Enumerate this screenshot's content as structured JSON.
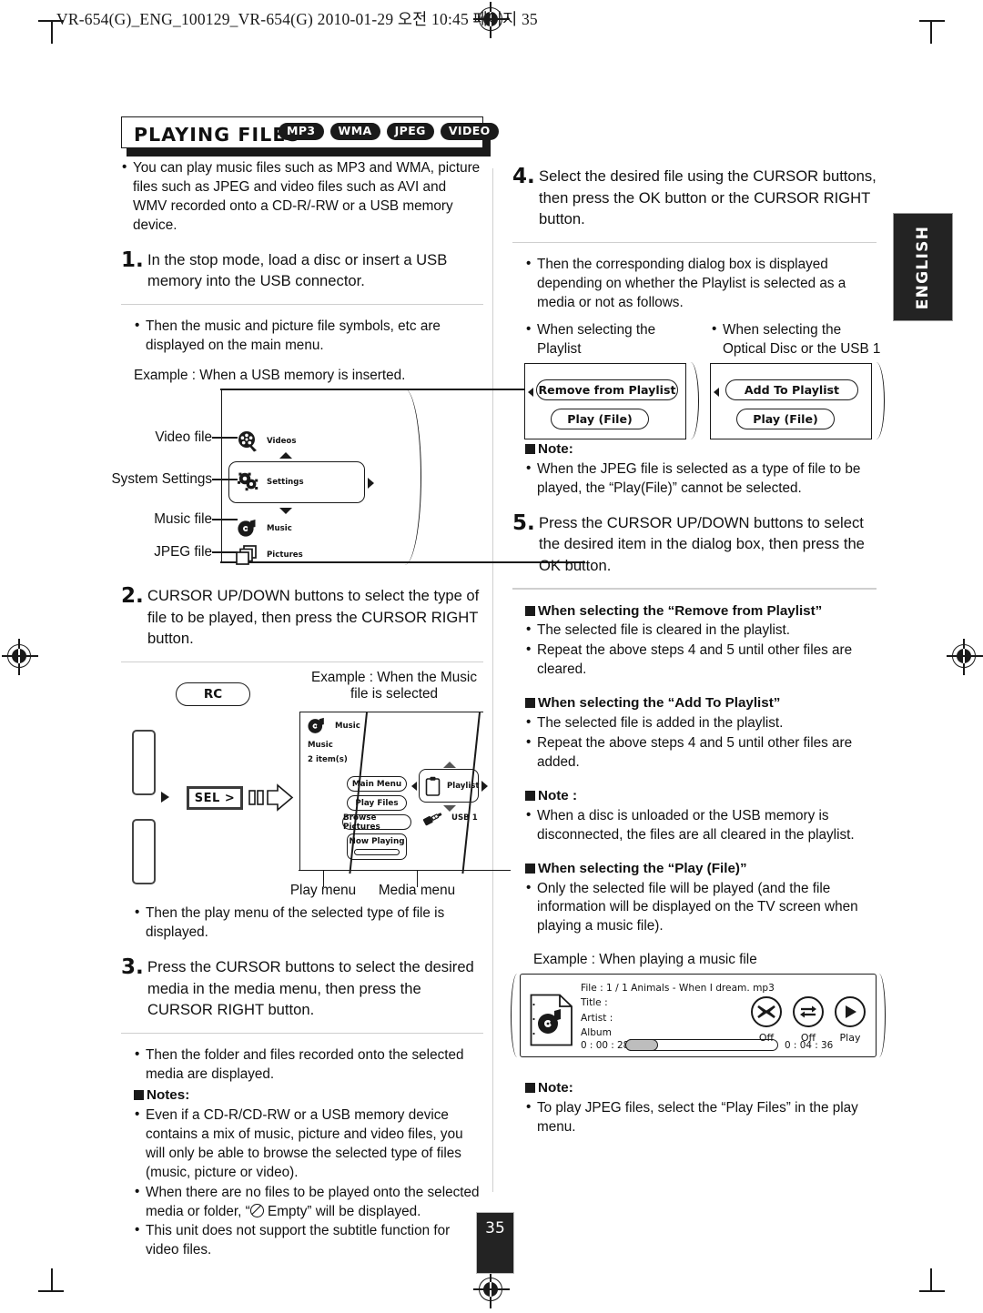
{
  "file_header": "VR-654(G)_ENG_100129_VR-654(G)  2010-01-29  오전 10:45  페이지 35",
  "side_tab": "ENGLISH",
  "page_number": "35",
  "banner": {
    "title": "PLAYING FILES",
    "badges": [
      "MP3",
      "WMA",
      "JPEG",
      "VIDEO"
    ]
  },
  "left": {
    "intro": "You can play music files such as MP3 and WMA, picture files such as JPEG and video files such as AVI and WMV recorded onto a CD-R/-RW or a USB memory device.",
    "step1_num": "1.",
    "step1_text": "In the stop mode, load a disc or insert a USB memory into the USB connector.",
    "note1": "Then the music and picture file symbols, etc are displayed on the main menu.",
    "example1": "Example : When a USB memory is inserted.",
    "diagram1": {
      "callouts": [
        "Video file",
        "System Settings",
        "Music file",
        "JPEG file"
      ],
      "items": [
        "Videos",
        "Settings",
        "Music",
        "Pictures"
      ]
    },
    "step2_num": "2.",
    "step2_text": "CURSOR UP/DOWN buttons to select the type of file to be played, then press the CURSOR RIGHT button.",
    "diagram2": {
      "rc_label": "RC",
      "sel_label": "SEL >",
      "example": "Example : When the Music file is selected",
      "screen_icon_label": "Music",
      "screen_folder": "Music",
      "screen_count": "2 item(s)",
      "play_menu_items": [
        "Main Menu",
        "Play Files",
        "Browse Pictures",
        "Now Playing"
      ],
      "media_menu_items": [
        "Playlist",
        "USB 1"
      ],
      "caption_play": "Play menu",
      "caption_media": "Media menu"
    },
    "note2": "Then the play menu of the selected type of file is displayed.",
    "step3_num": "3.",
    "step3_text": "Press the CURSOR buttons to select the desired media in the media menu, then press the CURSOR RIGHT button.",
    "note3": "Then the folder and files recorded onto the selected media are displayed.",
    "notes_heading": "Notes:",
    "notes_items": [
      "Even if a CD-R/CD-RW or a USB memory device contains a mix of music, picture and video files, you will only be able to browse the selected type of files (music, picture or video).",
      "When there are no files to be played onto the selected media or folder, “  Empty” will be displayed.",
      "This unit does not support the subtitle function for video files."
    ],
    "note_empty_pre": "When there are no files to be played onto the selected media or folder, “",
    "note_empty_post": " Empty” will be displayed."
  },
  "right": {
    "step4_num": "4.",
    "step4_text": "Select the desired file using the CURSOR buttons, then press the OK button or the CURSOR RIGHT button.",
    "note4": "Then the corresponding dialog box is displayed depending on whether the Playlist is selected as a media or not as follows.",
    "dialog_left_caption": "When selecting the Playlist",
    "dialog_right_caption": "When selecting the Optical Disc or the USB 1",
    "dialog_left_buttons": [
      "Remove from Playlist",
      "Play (File)"
    ],
    "dialog_right_buttons": [
      "Add To Playlist",
      "Play (File)"
    ],
    "note5_heading": "Note:",
    "note5_text": "When the JPEG file is selected as a type of file to be played, the “Play(File)” cannot be selected.",
    "step5_num": "5.",
    "step5_text": "Press the CURSOR UP/DOWN buttons to select the desired item in the dialog box, then press the OK button.",
    "sec_remove_heading": "When selecting the “Remove from Playlist”",
    "sec_remove_items": [
      "The selected file is cleared in the playlist.",
      "Repeat the above steps 4 and 5 until other files are cleared."
    ],
    "sec_add_heading": "When selecting the “Add To Playlist”",
    "sec_add_items": [
      "The selected file is added in the playlist.",
      "Repeat the above steps 4 and 5 until other files are added."
    ],
    "note6_heading": "Note :",
    "note6_text": "When a disc is unloaded or the USB memory is disconnected, the files are all cleared in the playlist.",
    "sec_play_heading": "When selecting the “Play (File)”",
    "sec_play_text": "Only the selected file will be played (and the file information will be displayed on the TV screen when playing a music file).",
    "example2": "Example : When playing a music file",
    "player": {
      "file_line": "File : 1 / 1 Animals - When I dream. mp3",
      "title_line": "Title :",
      "artist_line": "Artist :",
      "album_line": "Album",
      "time_elapsed": "0 : 00 : 28",
      "time_total": "0 : 04 : 36",
      "shuffle_label": "Off",
      "repeat_label": "Off",
      "play_label": "Play"
    },
    "note7_heading": "Note:",
    "note7_text": "To play JPEG files, select the “Play Files” in the play menu."
  },
  "colors": {
    "ink": "#1a1a1a",
    "tab_bg": "#232323",
    "rule": "#cfcfcf"
  }
}
